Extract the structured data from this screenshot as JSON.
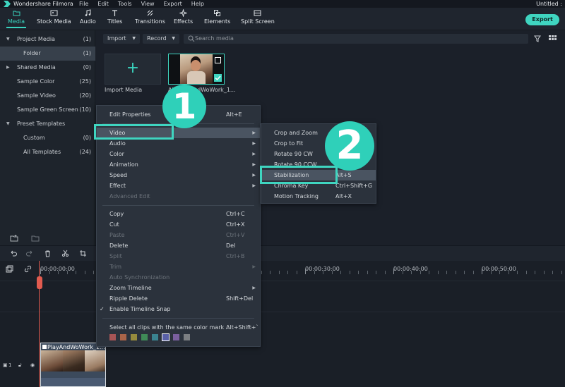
{
  "titlebar": {
    "app_name": "Wondershare Filmora",
    "menu": [
      "File",
      "Edit",
      "Tools",
      "View",
      "Export",
      "Help"
    ],
    "document": "Untitled :"
  },
  "toolbar": {
    "tabs": [
      {
        "label": "Media",
        "icon": "folder-icon",
        "active": true
      },
      {
        "label": "Stock Media",
        "icon": "image-icon"
      },
      {
        "label": "Audio",
        "icon": "music-note-icon"
      },
      {
        "label": "Titles",
        "icon": "text-t-icon"
      },
      {
        "label": "Transitions",
        "icon": "transition-icon"
      },
      {
        "label": "Effects",
        "icon": "sparkle-icon"
      },
      {
        "label": "Elements",
        "icon": "elements-icon"
      },
      {
        "label": "Split Screen",
        "icon": "split-screen-icon"
      }
    ],
    "export_label": "Export"
  },
  "sidebar": {
    "items": [
      {
        "label": "Project Media",
        "count": "(1)",
        "arrow": "▼"
      },
      {
        "label": "Folder",
        "count": "(1)",
        "selected": true
      },
      {
        "label": "Shared Media",
        "count": "(0)",
        "arrow": "▶"
      },
      {
        "label": "Sample Color",
        "count": "(25)"
      },
      {
        "label": "Sample Video",
        "count": "(20)"
      },
      {
        "label": "Sample Green Screen",
        "count": "(10)"
      },
      {
        "label": "Preset Templates",
        "count": "",
        "arrow": "▼"
      },
      {
        "label": "Custom",
        "count": "(0)"
      },
      {
        "label": "All Templates",
        "count": "(24)"
      }
    ]
  },
  "media": {
    "import_label": "Import",
    "record_label": "Record",
    "search_placeholder": "Search media",
    "import_media_label": "Import Media",
    "clip_label": "All_PlayAndWoWork_1..."
  },
  "context_menu": {
    "items": [
      {
        "label": "Edit Properties",
        "shortcut": "Alt+E"
      },
      {
        "label": "Video",
        "submenu": true,
        "highlighted": true
      },
      {
        "label": "Audio",
        "submenu": true
      },
      {
        "label": "Color",
        "submenu": true
      },
      {
        "label": "Animation",
        "submenu": true
      },
      {
        "label": "Speed",
        "submenu": true
      },
      {
        "label": "Effect",
        "submenu": true
      },
      {
        "label": "Advanced Edit",
        "disabled": true
      },
      {
        "label": "Copy",
        "shortcut": "Ctrl+C"
      },
      {
        "label": "Cut",
        "shortcut": "Ctrl+X"
      },
      {
        "label": "Paste",
        "shortcut": "Ctrl+V",
        "disabled": true
      },
      {
        "label": "Delete",
        "shortcut": "Del"
      },
      {
        "label": "Split",
        "shortcut": "Ctrl+B",
        "disabled": true
      },
      {
        "label": "Trim",
        "submenu": true,
        "disabled": true
      },
      {
        "label": "Auto Synchronization",
        "disabled": true
      },
      {
        "label": "Zoom Timeline",
        "submenu": true
      },
      {
        "label": "Ripple Delete",
        "shortcut": "Shift+Del"
      },
      {
        "label": "Enable Timeline Snap",
        "checked": true
      },
      {
        "label": "Select all clips with the same color mark",
        "shortcut": "Alt+Shift+`"
      }
    ],
    "color_marks": [
      "#a65455",
      "#a96448",
      "#968b3d",
      "#3f8a57",
      "#3a8390",
      "#5960a7",
      "#7a5f9e",
      "#7c7f82"
    ]
  },
  "video_submenu": {
    "items": [
      {
        "label": "Crop and Zoom",
        "shortcut": ""
      },
      {
        "label": "Crop to Fit",
        "shortcut": ""
      },
      {
        "label": "Rotate 90 CW",
        "shortcut": ""
      },
      {
        "label": "Rotate 90 CCW",
        "shortcut": ""
      },
      {
        "label": "Stabilization",
        "shortcut": "Alt+S"
      },
      {
        "label": "Chroma Key",
        "shortcut": "Ctrl+Shift+G"
      },
      {
        "label": "Motion Tracking",
        "shortcut": "Alt+X"
      }
    ]
  },
  "callouts": {
    "one": "1",
    "two": "2"
  },
  "timeline": {
    "ruler_labels": [
      "00:00:00:00",
      "00:00:30:00",
      "00:00:40:00",
      "00:00:50:00"
    ],
    "clip_name": "PlayAndWoWork_1...",
    "track_label": "1"
  }
}
